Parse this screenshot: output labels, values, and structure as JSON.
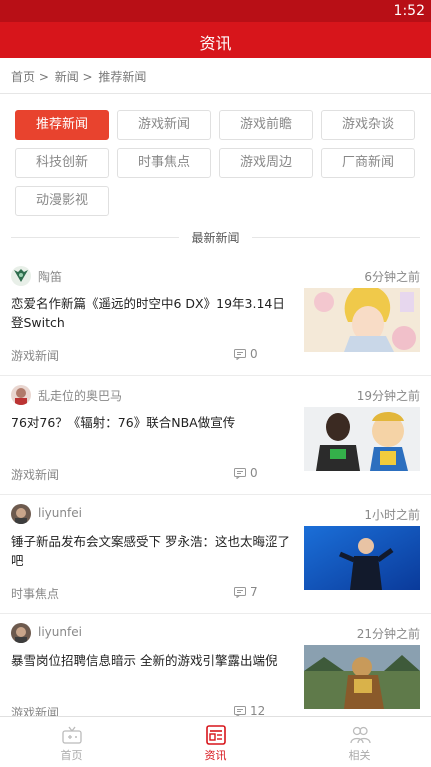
{
  "status_bar": {
    "time": "1:52"
  },
  "header": {
    "title": "资讯"
  },
  "breadcrumb": {
    "home": "首页 >",
    "news": "新闻 >",
    "current": "推荐新闻"
  },
  "categories": [
    {
      "label": "推荐新闻",
      "active": true
    },
    {
      "label": "游戏新闻",
      "active": false
    },
    {
      "label": "游戏前瞻",
      "active": false
    },
    {
      "label": "游戏杂谈",
      "active": false
    },
    {
      "label": "科技创新",
      "active": false
    },
    {
      "label": "时事焦点",
      "active": false
    },
    {
      "label": "游戏周边",
      "active": false
    },
    {
      "label": "厂商新闻",
      "active": false
    },
    {
      "label": "动漫影视",
      "active": false
    }
  ],
  "section": {
    "title": "最新新闻"
  },
  "news": [
    {
      "author": "陶笛",
      "time_ago": "6分钟之前",
      "headline": "恋爱名作新篇《遥远的时空中6 DX》19年3.14日登Switch",
      "tag": "游戏新闻",
      "comments": "0"
    },
    {
      "author": "乱走位的奥巴马",
      "time_ago": "19分钟之前",
      "headline": "76对76？《辐射：76》联合NBA做宣传",
      "tag": "游戏新闻",
      "comments": "0"
    },
    {
      "author": "liyunfei",
      "time_ago": "1小时之前",
      "headline": "锤子新品发布会文案感受下 罗永浩：这也太晦涩了吧",
      "tag": "时事焦点",
      "comments": "7"
    },
    {
      "author": "liyunfei",
      "time_ago": "21分钟之前",
      "headline": "暴雪岗位招聘信息暗示 全新的游戏引擎露出端倪",
      "tag": "游戏新闻",
      "comments": "12"
    }
  ],
  "tabbar": [
    {
      "label": "首页",
      "icon": "home-icon",
      "active": false
    },
    {
      "label": "资讯",
      "icon": "news-icon",
      "active": true
    },
    {
      "label": "相关",
      "icon": "people-icon",
      "active": false
    }
  ],
  "colors": {
    "primary": "#d7151b",
    "status_bar": "#b80f16",
    "active_chip": "#e8432e"
  }
}
